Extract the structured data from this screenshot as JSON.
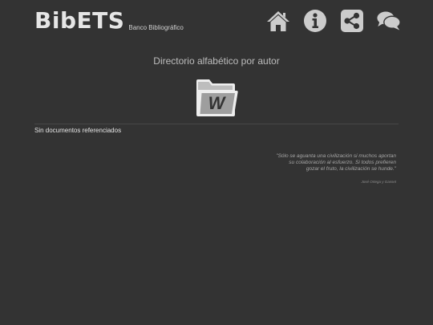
{
  "header": {
    "logo_text": "BibETS",
    "logo_subtitle": "Banco Bibliográfico",
    "nav": [
      {
        "icon": "home-icon"
      },
      {
        "icon": "info-icon"
      },
      {
        "icon": "share-icon"
      },
      {
        "icon": "comments-icon"
      }
    ]
  },
  "main": {
    "title": "Directorio alfabético por autor",
    "folder_letter": "W",
    "empty_message": "Sin documentos referenciados"
  },
  "quote": {
    "text": "\"Sólo se aguanta una civilización si muchos aportan su colaboración al esfuerzo. Si todos prefieren gozar el fruto, la civilización se hunde.\"",
    "author": "José Ortega y Gasset"
  },
  "colors": {
    "background": "#333333",
    "icon": "#cccccc",
    "text": "#e6e6e6"
  }
}
